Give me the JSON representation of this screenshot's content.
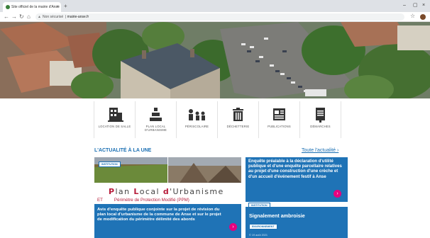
{
  "browser": {
    "tab_title": "Site officiel de la mairie d'Anse",
    "address_host": "Non sécurisé",
    "address_path": "mairie-anse.fr"
  },
  "quick_links": [
    {
      "label": "Location de salle",
      "icon": "building-icon"
    },
    {
      "label": "Plan local d'urbanisme",
      "icon": "pyramid-icon"
    },
    {
      "label": "Périscolaire",
      "icon": "children-icon"
    },
    {
      "label": "Déchetterie",
      "icon": "trash-icon"
    },
    {
      "label": "Publications",
      "icon": "newspaper-icon"
    },
    {
      "label": "Démarches",
      "icon": "document-icon"
    }
  ],
  "news": {
    "section_title": "L'ACTUALITÉ À LA UNE",
    "all_link": "Toute l'actualité ›",
    "main": {
      "tag": "Institution",
      "plu_title": "Plan Local d'Urbanisme",
      "plu_et": "ET",
      "plu_subtitle": "Périmètre de Protection Modifié (PPM)",
      "text": "Avis d'enquête publique conjointe sur la projet de révision du plan local d'urbanisme de la commune de Anse et sur le projet de modification du périmètre délimité des abords"
    },
    "side1": {
      "text": "Enquête préalable à la déclaration d'utilité publique et d'une enquête parcellaire relatives au projet d'une construction d'une crèche et d'un accueil d'événement festif à Anse",
      "tag": "Institution"
    },
    "side2": {
      "title": "Signalement ambroisie",
      "tag": "Environnement",
      "date": "© 19 août 2021"
    }
  },
  "colors": {
    "brand_blue": "#1f73b6",
    "accent_pink": "#e6007e",
    "plu_red": "#b71c3a"
  }
}
